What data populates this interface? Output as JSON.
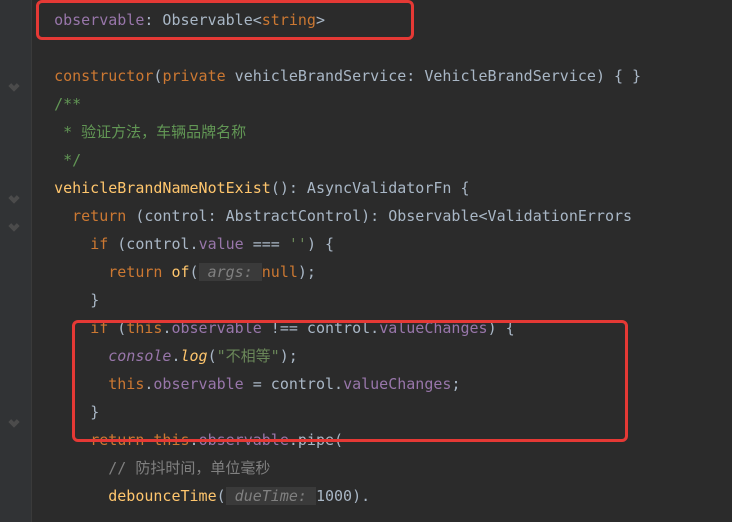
{
  "code": {
    "l1": {
      "indent": "  ",
      "a": "observable",
      "b": ": Observable<",
      "c": "string",
      "d": ">"
    },
    "l2": {
      "indent": "  ",
      "a": "constructor",
      "b": "(",
      "c": "private",
      "d": " vehicleBrandService",
      "e": ": VehicleBrandService",
      "f": ") { }"
    },
    "l3": {
      "indent": "  ",
      "a": "/**"
    },
    "l4": {
      "indent": "   ",
      "a": "* 验证方法，车辆品牌名称"
    },
    "l5": {
      "indent": "   ",
      "a": "*/"
    },
    "l6": {
      "indent": "  ",
      "a": "vehicleBrandNameNotExist",
      "b": "(): AsyncValidatorFn {"
    },
    "l7": {
      "indent": "    ",
      "a": "return ",
      "b": "(control: AbstractControl): Observable<ValidationErrors"
    },
    "l8": {
      "indent": "      ",
      "a": "if ",
      "b": "(control.",
      "c": "value",
      "d": " === ",
      "e": "''",
      "f": ") {"
    },
    "l9": {
      "indent": "        ",
      "a": "return ",
      "b": "of",
      "c": "(",
      "d": " args: ",
      "e": "null",
      "f": ");"
    },
    "l10": {
      "indent": "      ",
      "a": "}"
    },
    "l11": {
      "indent": "      ",
      "a": "if ",
      "b": "(",
      "c": "this",
      "d": ".",
      "e": "observable",
      "f": " !== control.",
      "g": "valueChanges",
      "h": ") {"
    },
    "l12": {
      "indent": "        ",
      "a": "console",
      "b": ".",
      "c": "log",
      "d": "(",
      "e": "\"不相等\"",
      "f": ");"
    },
    "l13": {
      "indent": "        ",
      "a": "this",
      "b": ".",
      "c": "observable",
      "d": " = control.",
      "e": "valueChanges",
      "f": ";"
    },
    "l14": {
      "indent": "      ",
      "a": "}"
    },
    "l15": {
      "indent": "      ",
      "a": "return ",
      "b": "this",
      "c": ".",
      "d": "observable",
      "e": ".pipe("
    },
    "l16": {
      "indent": "        ",
      "a": "// 防抖时间，单位毫秒"
    },
    "l17": {
      "indent": "        ",
      "a": "debounceTime",
      "b": "(",
      "c": " dueTime: ",
      "d": "1000",
      "e": ")."
    }
  }
}
